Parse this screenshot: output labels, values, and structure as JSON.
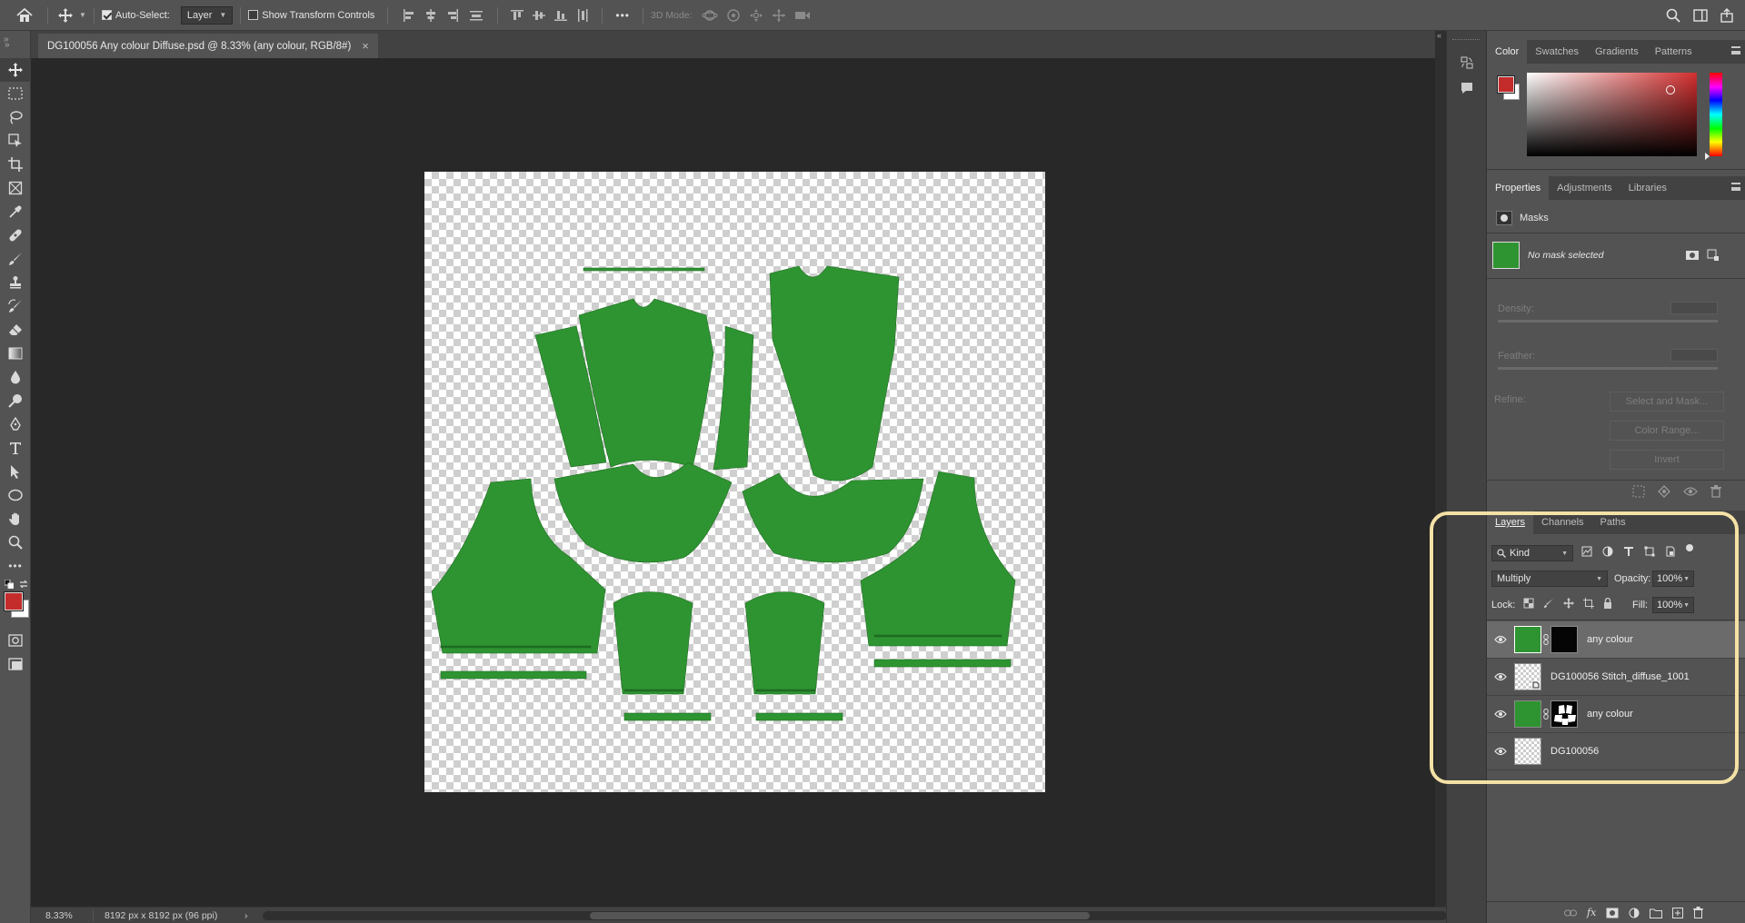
{
  "options_bar": {
    "auto_select_label": "Auto-Select:",
    "auto_select_checked": true,
    "auto_select_target": "Layer",
    "show_transform_label": "Show Transform Controls",
    "show_transform_checked": false,
    "mode_3d_label": "3D Mode:",
    "more_glyph": "•••"
  },
  "document": {
    "tab_title": "DG100056 Any colour Diffuse.psd @ 8.33% (any colour, RGB/8#)",
    "close_glyph": "×"
  },
  "status_bar": {
    "zoom": "8.33%",
    "doc_info": "8192 px x 8192 px (96 ppi)",
    "arrow": "›"
  },
  "color_panel": {
    "tabs": [
      "Color",
      "Swatches",
      "Gradients",
      "Patterns"
    ],
    "active_tab": "Color",
    "foreground": "#c42b2b",
    "background": "#ffffff",
    "picker_hue": "#d42f2f"
  },
  "properties_panel": {
    "tabs": [
      "Properties",
      "Adjustments",
      "Libraries"
    ],
    "active_tab": "Properties",
    "section_title": "Masks",
    "mask_status": "No mask selected",
    "density_label": "Density:",
    "feather_label": "Feather:",
    "refine_label": "Refine:",
    "select_and_mask": "Select and Mask...",
    "color_range": "Color Range...",
    "invert": "Invert"
  },
  "layers_panel": {
    "tabs": [
      "Layers",
      "Channels",
      "Paths"
    ],
    "active_tab": "Layers",
    "filter_kind": "Kind",
    "blend_mode": "Multiply",
    "opacity_label": "Opacity:",
    "opacity_value": "100%",
    "lock_label": "Lock:",
    "fill_label": "Fill:",
    "fill_value": "100%",
    "layers": [
      {
        "name": "any colour",
        "thumb": "green",
        "mask": "black",
        "selected": true
      },
      {
        "name": "DG100056 Stitch_diffuse_1001",
        "thumb": "checker",
        "mask": null,
        "selected": false
      },
      {
        "name": "any colour",
        "thumb": "green",
        "mask": "bw",
        "selected": false
      },
      {
        "name": "DG100056",
        "thumb": "checker",
        "mask": null,
        "selected": false
      }
    ]
  },
  "colors": {
    "ui_bg": "#535353",
    "panel_dark": "#424242",
    "canvas_bg": "#282828",
    "pattern_green": "#2e9431",
    "highlight": "#f4e1a6"
  }
}
